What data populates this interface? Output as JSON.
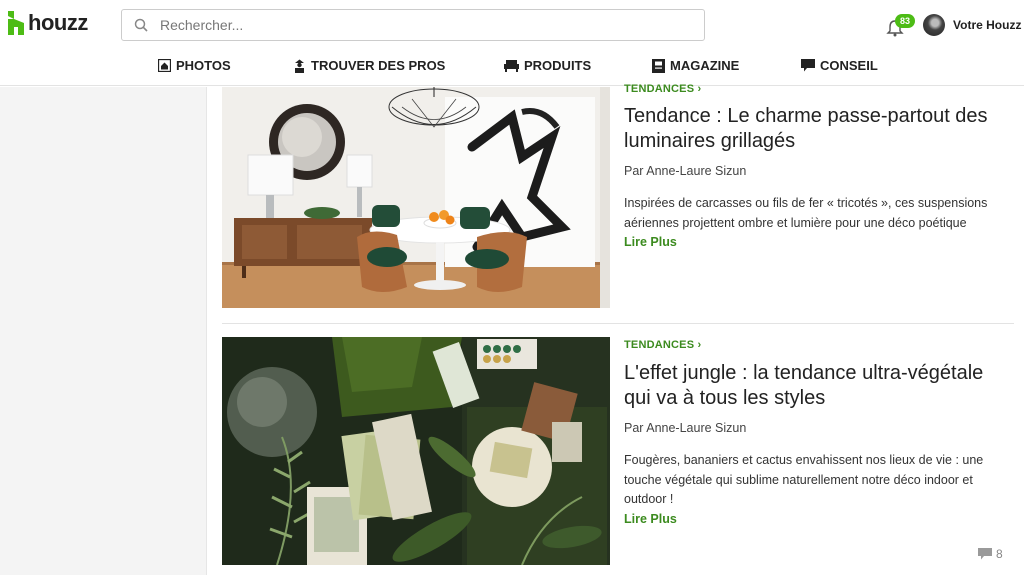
{
  "brand": {
    "name": "houzz",
    "color": "#4dbc15"
  },
  "search": {
    "placeholder": "Rechercher..."
  },
  "header": {
    "notification_count": "83",
    "user_label": "Votre Houzz"
  },
  "nav": [
    {
      "label": "PHOTOS",
      "icon": "home-photo-icon"
    },
    {
      "label": "TROUVER DES PROS",
      "icon": "professional-icon"
    },
    {
      "label": "PRODUITS",
      "icon": "sofa-icon"
    },
    {
      "label": "MAGAZINE",
      "icon": "magazine-icon"
    },
    {
      "label": "CONSEIL",
      "icon": "speech-bubble-icon"
    }
  ],
  "articles": [
    {
      "category": "TENDANCES ›",
      "title": "Tendance : Le charme passe-partout des luminaires grillagés",
      "author": "Par Anne-Laure Sizun",
      "excerpt": "Inspirées de carcasses ou fils de fer « tricotés », ces suspensions aériennes projettent ombre et lumière pour une déco poétique",
      "more": "Lire Plus",
      "image": "dining-room-wire-pendant-photo"
    },
    {
      "category": "TENDANCES ›",
      "title": "L'effet jungle : la tendance ultra-végétale qui va à tous les styles",
      "author": "Par Anne-Laure Sizun",
      "excerpt": "Fougères, bananiers et cactus envahissent nos lieux de vie : une touche végétale qui sublime naturellement notre déco indoor et outdoor !",
      "more": "Lire Plus",
      "image": "botanical-flatlay-photo",
      "comments": "8"
    }
  ],
  "colors": {
    "accent_green": "#3c8b1f",
    "sidebar_bg": "#f4f4f4"
  }
}
